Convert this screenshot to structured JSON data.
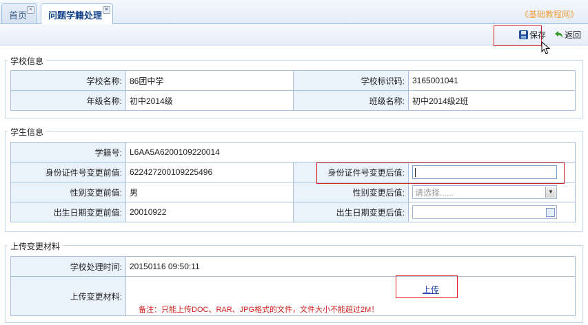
{
  "tabs": [
    {
      "label": "首页"
    },
    {
      "label": "问题学籍处理"
    }
  ],
  "brand": "《基础教程网》",
  "toolbar": {
    "save_label": "保存",
    "back_label": "返回"
  },
  "school_section": {
    "title": "学校信息",
    "school_name_label": "学校名称:",
    "school_name": "86团中学",
    "school_code_label": "学校标识码:",
    "school_code": "3165001041",
    "grade_label": "年级名称:",
    "grade": "初中2014级",
    "class_label": "班级名称:",
    "class": "初中2014级2班"
  },
  "student_section": {
    "title": "学生信息",
    "student_id_label": "学籍号:",
    "student_id": "L6AA5A6200109220014",
    "id_before_label": "身份证件号变更前值:",
    "id_before": "622427200109225496",
    "id_after_label": "身份证件号变更后值:",
    "id_after": "",
    "gender_before_label": "性别变更前值:",
    "gender_before": "男",
    "gender_after_label": "性别变更后值:",
    "gender_after_placeholder": "请选择......",
    "dob_before_label": "出生日期变更前值:",
    "dob_before": "20010922",
    "dob_after_label": "出生日期变更后值:",
    "dob_after": ""
  },
  "upload_section": {
    "title": "上传变更材料",
    "process_time_label": "学校处理时间:",
    "process_time": "20150116 09:50:11",
    "upload_label": "上传变更材料:",
    "upload_link": "上传",
    "note": "备注：只能上传DOC、RAR、JPG格式的文件，文件大小不能超过2M！"
  },
  "icons": [
    "close-icon",
    "save-disk-icon",
    "back-arrow-icon",
    "dropdown-arrow-icon",
    "calendar-icon",
    "mouse-cursor-icon"
  ],
  "colors": {
    "highlight": "#dd2222",
    "label_bg": "#eaf3fc",
    "note": "#d41c1c",
    "link": "#1a3fa8"
  }
}
